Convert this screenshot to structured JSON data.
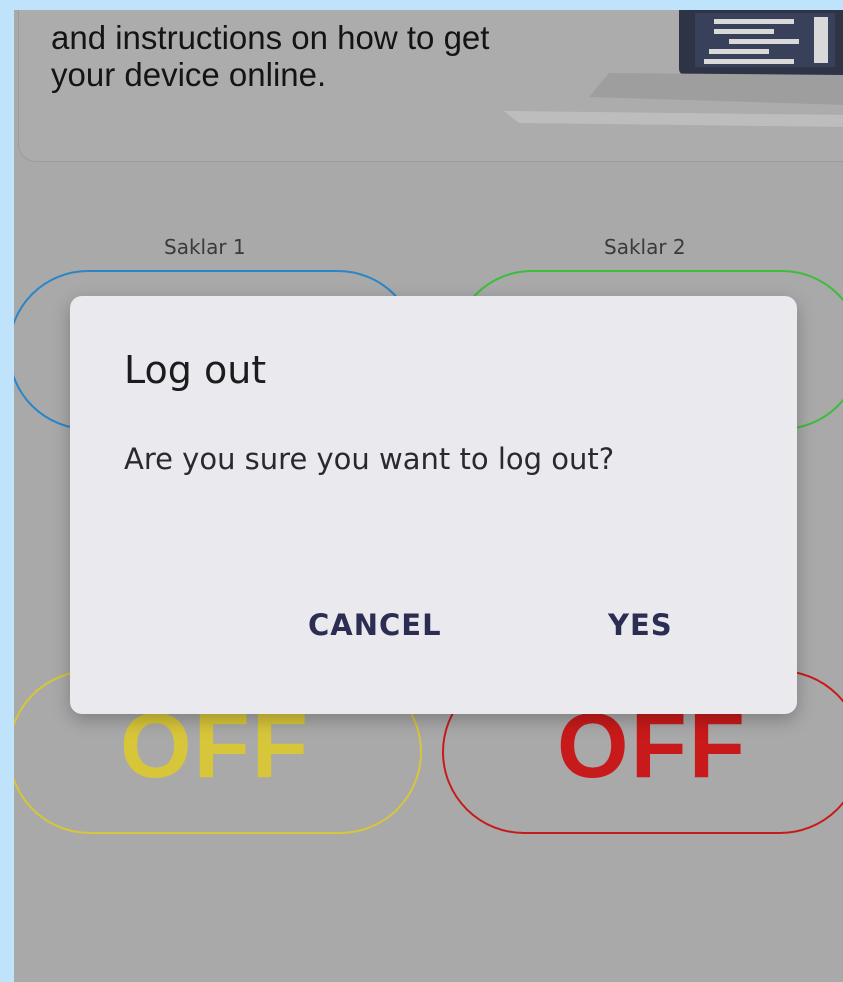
{
  "info_card": {
    "text_line1": "and instructions on how to get",
    "text_line2": "your device online."
  },
  "switches": [
    {
      "label": "Saklar 1",
      "color": "#2a86c8"
    },
    {
      "label": "Saklar 2",
      "color": "#3cbd3c"
    },
    {
      "label": "",
      "state": "OFF",
      "color": "#d8c63a"
    },
    {
      "label": "",
      "state": "OFF",
      "color": "#c81a1a"
    }
  ],
  "dialog": {
    "title": "Log out",
    "message": "Are you sure you want to log out?",
    "cancel_label": "CANCEL",
    "confirm_label": "YES"
  },
  "colors": {
    "frame": "#bfe3fb",
    "scrim": "#a9a9a9",
    "dialog_bg": "#e9e9ee",
    "button_text": "#2b2d52"
  }
}
